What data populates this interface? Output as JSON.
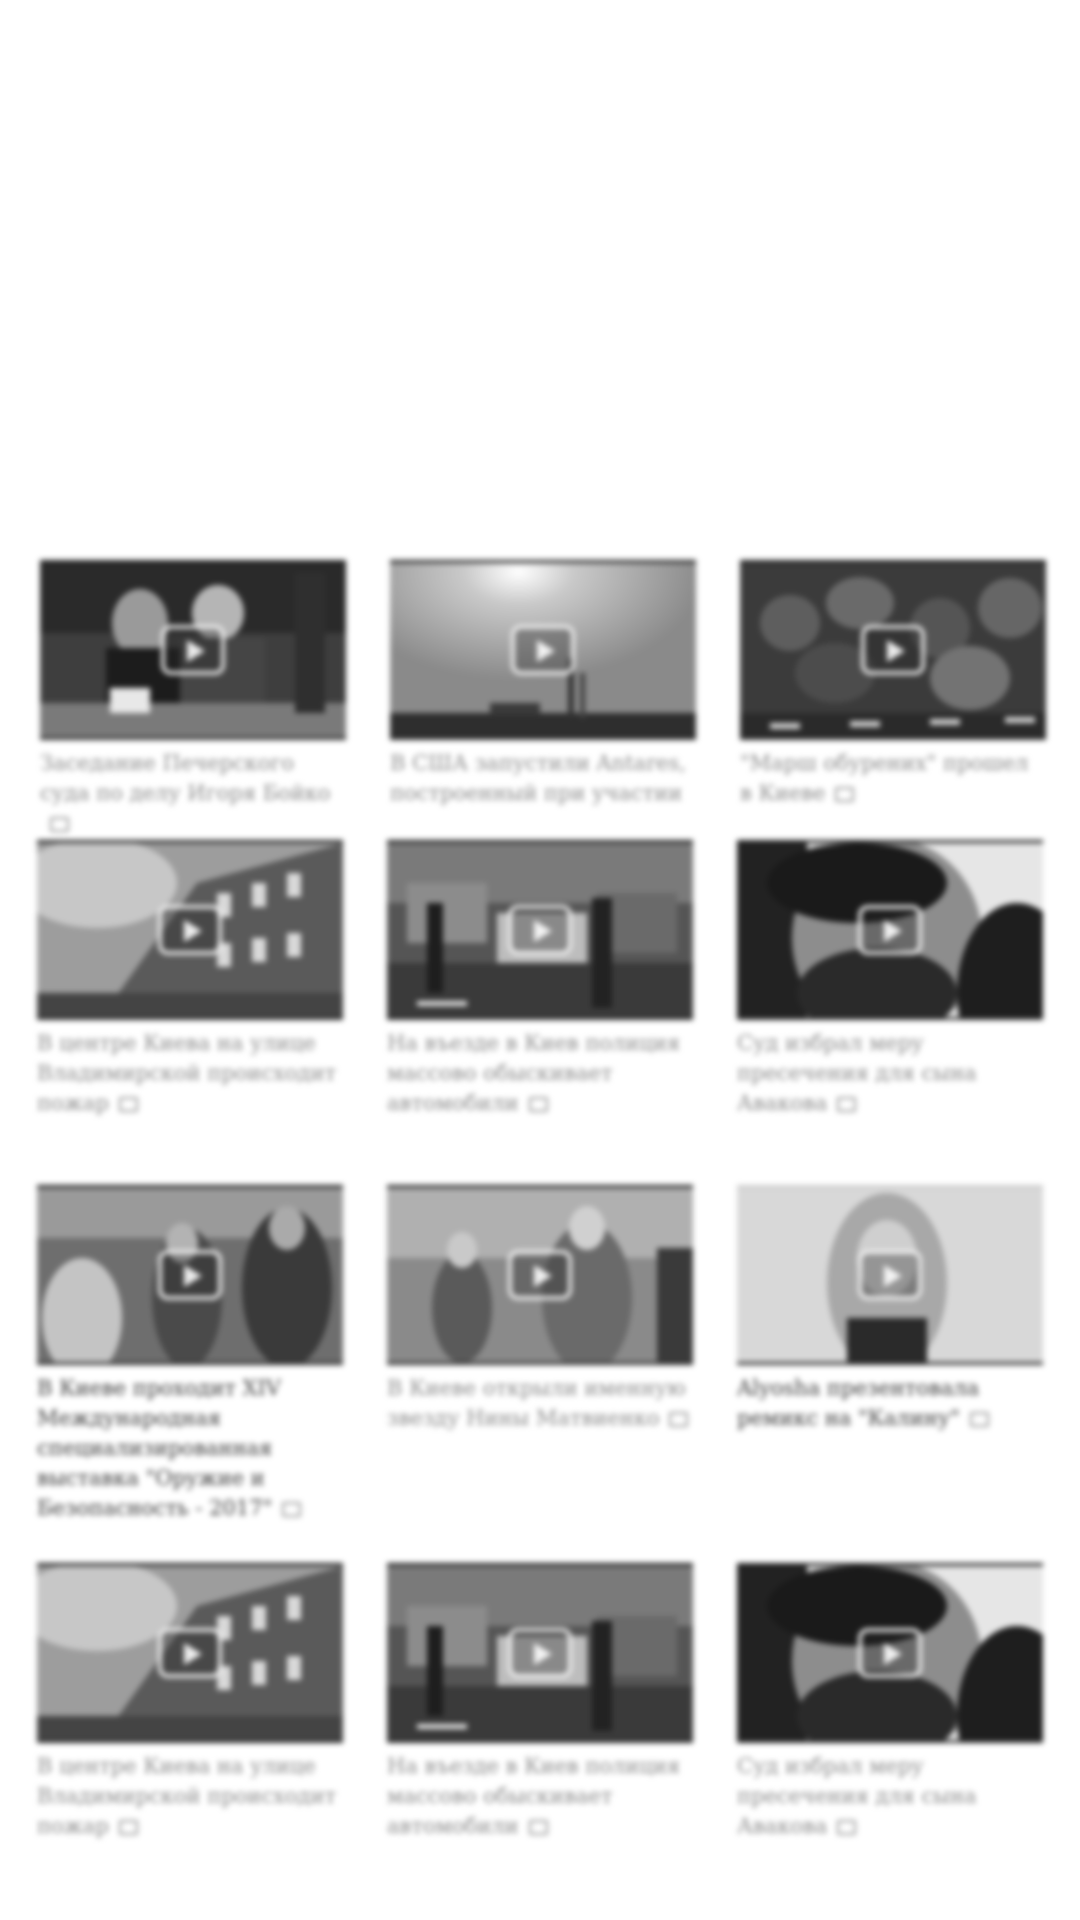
{
  "videos": [
    {
      "title": "Заседание Печерского суда по делу Игоря Бойко",
      "scene": "courtroom"
    },
    {
      "title": "В США запустили Antares, построенный при участии украинских специалистов",
      "scene": "rocket"
    },
    {
      "title": "\"Марш обурених\" прошел в Киеве",
      "scene": "crowd"
    },
    {
      "title": "В центре Киева на улице Владимирской происходит пожар",
      "scene": "building"
    },
    {
      "title": "На въезде в Киев полиция массово обыскивает автомобили",
      "scene": "street"
    },
    {
      "title": "Суд избрал меру пресечения для сына Авакова",
      "scene": "portrait"
    },
    {
      "title": "В Киеве проходит XIV Международная специализированная выставка \"Оружие и Безопасность - 2017\"",
      "scene": "expo"
    },
    {
      "title": "В Киеве открыли именную звезду Нины Матвиенко",
      "scene": "ceremony"
    },
    {
      "title": "Alyosha презентовала ремикс на \"Калину\"",
      "scene": "singer"
    },
    {
      "title": "В центре Киева на улице Владимирской происходит пожар",
      "scene": "building"
    },
    {
      "title": "На въезде в Киев полиция массово обыскивает автомобили",
      "scene": "street"
    },
    {
      "title": "Суд избрал меру пресечения для сына Авакова",
      "scene": "portrait"
    }
  ],
  "icons": {
    "video_badge": "camera-icon",
    "play": "play-icon"
  }
}
